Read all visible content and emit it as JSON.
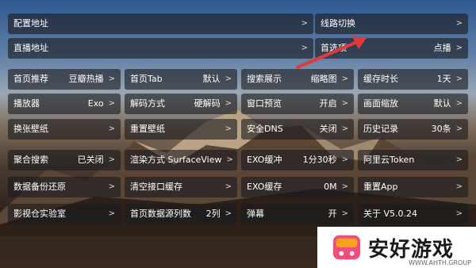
{
  "rows": [
    [
      {
        "label": "配置地址",
        "value": "",
        "chev": ">"
      },
      {
        "label": "线路切换",
        "value": "",
        "chev": ">"
      }
    ],
    [
      {
        "label": "直播地址",
        "value": "",
        "chev": ">"
      },
      {
        "label": "首选项",
        "value": "点播",
        "chev": ">"
      }
    ],
    [
      {
        "label": "首页推荐",
        "value": "豆瓣热播",
        "chev": ">"
      },
      {
        "label": "首页Tab",
        "value": "默认",
        "chev": ">"
      },
      {
        "label": "搜索展示",
        "value": "缩略图",
        "chev": ">"
      },
      {
        "label": "缓存时长",
        "value": "1天",
        "chev": ">"
      }
    ],
    [
      {
        "label": "播放器",
        "value": "Exo",
        "chev": ">"
      },
      {
        "label": "解码方式",
        "value": "硬解码",
        "chev": ">"
      },
      {
        "label": "窗口预览",
        "value": "开启",
        "chev": ">"
      },
      {
        "label": "画面缩放",
        "value": "默认",
        "chev": ">"
      }
    ],
    [
      {
        "label": "换张壁纸",
        "value": "",
        "chev": ">"
      },
      {
        "label": "重置壁纸",
        "value": "",
        "chev": ">"
      },
      {
        "label": "安全DNS",
        "value": "关闭",
        "chev": ">"
      },
      {
        "label": "历史记录",
        "value": "30条",
        "chev": ">"
      }
    ],
    [
      {
        "label": "聚合搜索",
        "value": "已关闭",
        "chev": ">"
      },
      {
        "label": "渲染方式 SurfaceView",
        "value": "",
        "chev": ">"
      },
      {
        "label": "EXO缓冲",
        "value": "1分30秒",
        "chev": ">"
      },
      {
        "label": "阿里云Token",
        "value": "",
        "chev": ">"
      }
    ],
    [
      {
        "label": "数据备份还原",
        "value": "",
        "chev": ">"
      },
      {
        "label": "清空接口缓存",
        "value": "",
        "chev": ">"
      },
      {
        "label": "EXO缓存",
        "value": "0M",
        "chev": ">"
      },
      {
        "label": "重置App",
        "value": "",
        "chev": ">"
      }
    ],
    [
      {
        "label": "影视仓实验室",
        "value": "",
        "chev": ">"
      },
      {
        "label": "首页数据源列数",
        "value": "2列",
        "chev": ">"
      },
      {
        "label": "弹幕",
        "value": "开",
        "chev": ">"
      },
      {
        "label": "关于  V5.0.24",
        "value": "",
        "chev": ">"
      }
    ]
  ],
  "watermark": {
    "brand": "安好游戏",
    "url": "WWW.AHTH.GROUP",
    "colors": {
      "pink": "#f04d7a",
      "orange": "#f7a21b",
      "text": "#1a1a1a"
    }
  },
  "annotation": {
    "arrow_color": "#e23a3a",
    "icon": "arrow-annotation"
  }
}
